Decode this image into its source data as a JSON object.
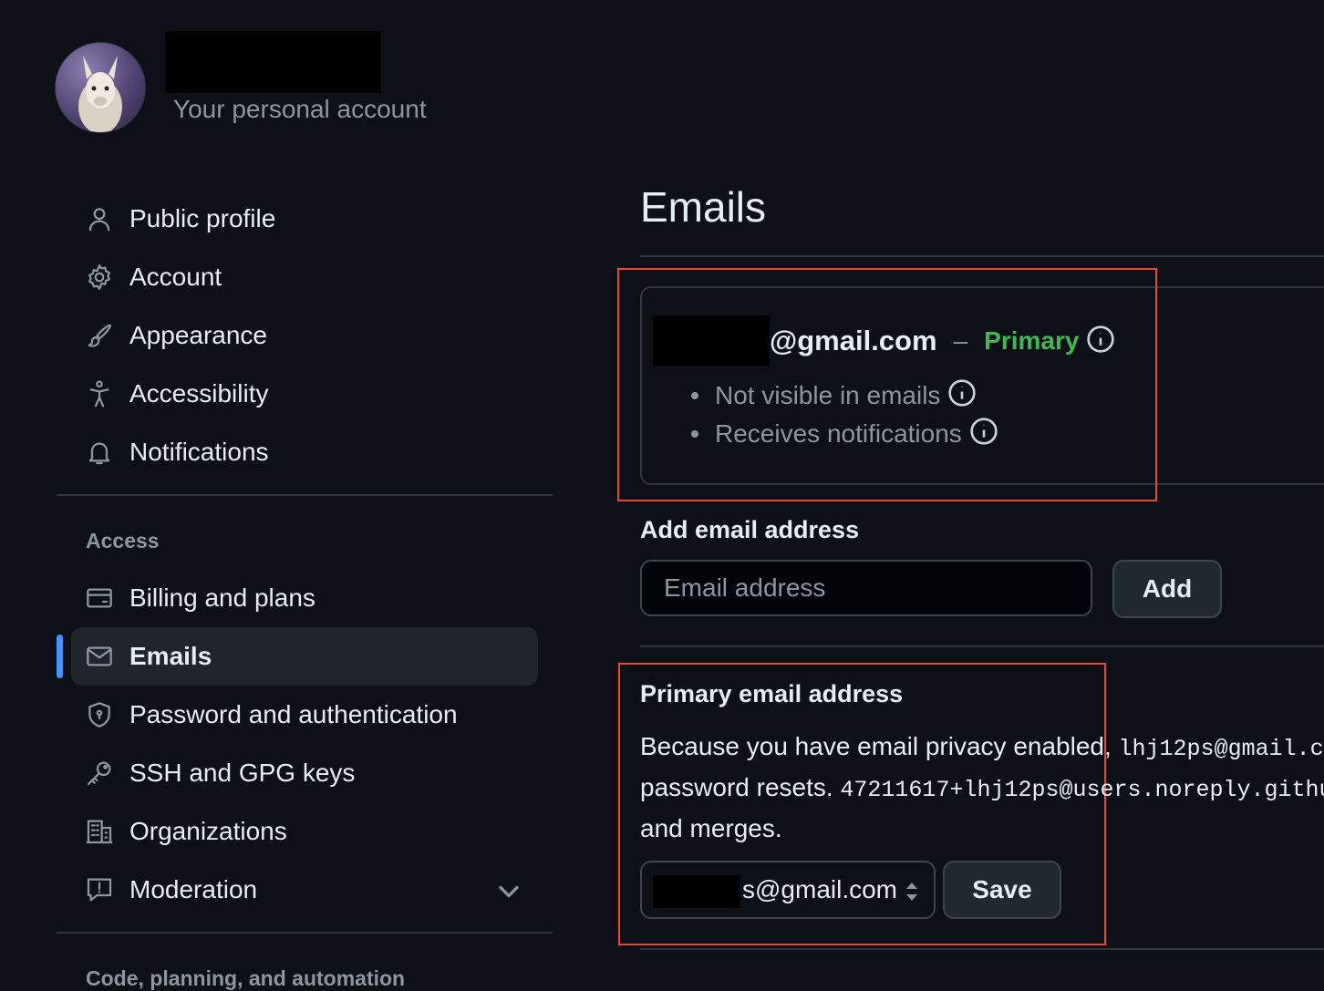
{
  "header": {
    "account_subtitle": "Your personal account"
  },
  "sidebar": {
    "items": [
      {
        "label": "Public profile",
        "icon": "person-icon"
      },
      {
        "label": "Account",
        "icon": "gear-icon"
      },
      {
        "label": "Appearance",
        "icon": "paintbrush-icon"
      },
      {
        "label": "Accessibility",
        "icon": "accessibility-icon"
      },
      {
        "label": "Notifications",
        "icon": "bell-icon"
      }
    ],
    "access_heading": "Access",
    "access_items": [
      {
        "label": "Billing and plans",
        "icon": "credit-card-icon"
      },
      {
        "label": "Emails",
        "icon": "mail-icon",
        "active": true
      },
      {
        "label": "Password and authentication",
        "icon": "shield-icon"
      },
      {
        "label": "SSH and GPG keys",
        "icon": "key-icon"
      },
      {
        "label": "Organizations",
        "icon": "organization-icon"
      },
      {
        "label": "Moderation",
        "icon": "report-icon"
      }
    ],
    "code_heading": "Code, planning, and automation"
  },
  "main": {
    "title": "Emails",
    "primary_email": {
      "domain": "@gmail.com",
      "separator": "–",
      "badge": "Primary",
      "bullets": [
        "Not visible in emails",
        "Receives notifications"
      ]
    },
    "add_email": {
      "heading": "Add email address",
      "placeholder": "Email address",
      "button": "Add"
    },
    "primary_section": {
      "heading": "Primary email address",
      "text_1": "Because you have email privacy enabled, ",
      "mono_1": "lhj12ps@gmail.c",
      "text_2": "password resets. ",
      "mono_2": "47211617+lhj12ps@users.noreply.githul",
      "text_3": "and merges.",
      "select_value": "s@gmail.com",
      "save_button": "Save"
    }
  },
  "colors": {
    "background": "#0d1117",
    "accent": "#4493f8",
    "primary_badge": "#3fb950",
    "annotation_box": "#e5483a"
  }
}
